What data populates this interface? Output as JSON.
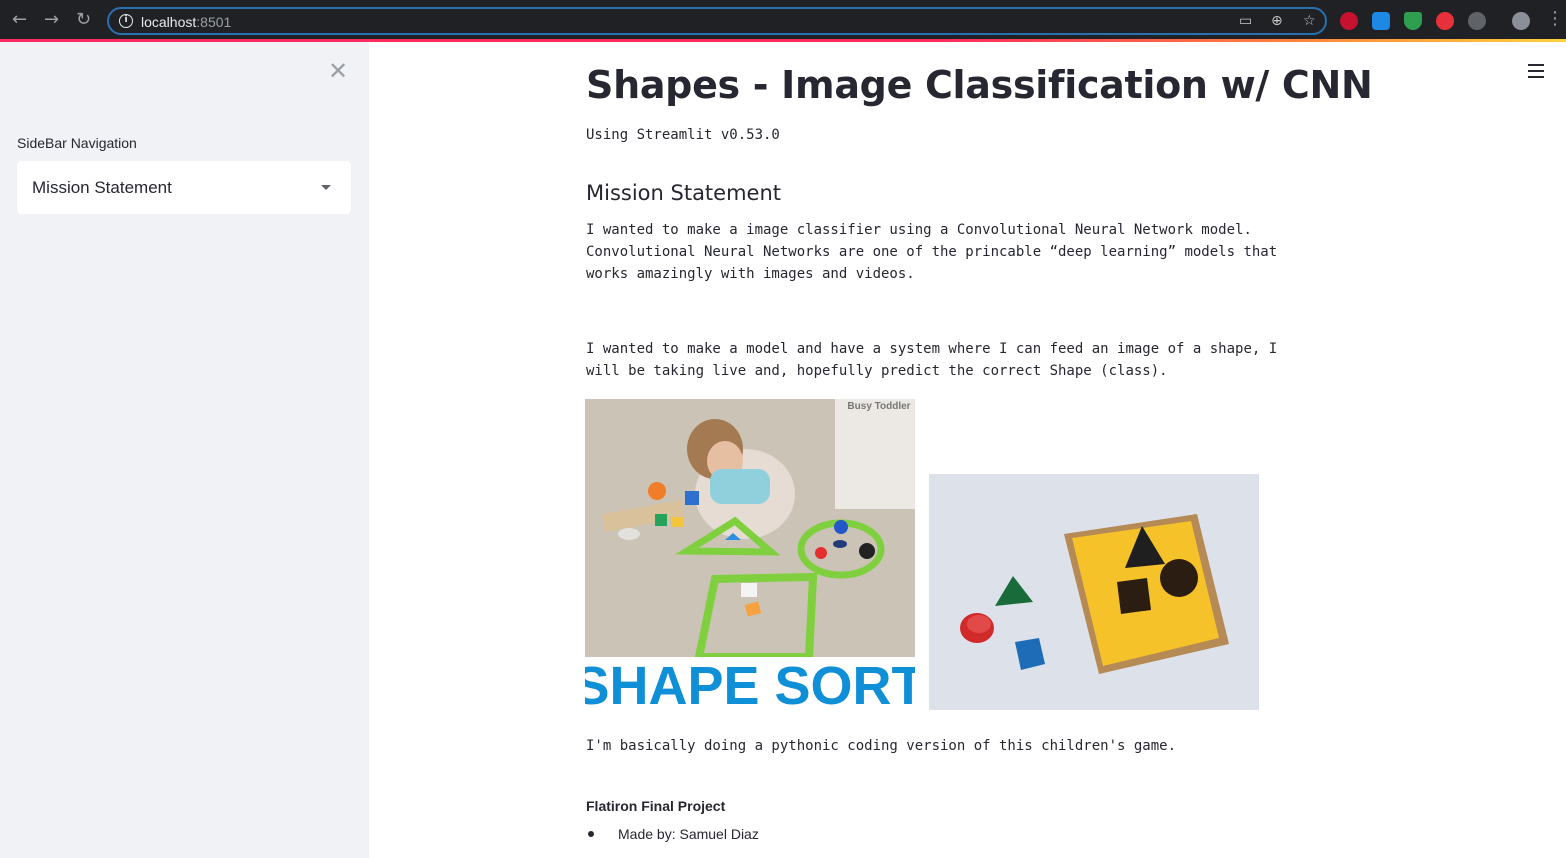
{
  "browser": {
    "url_host": "localhost",
    "url_port": ":8501",
    "extensions": [
      "ABP",
      "trello",
      "shield",
      "stop",
      "puzzle",
      "avatar"
    ]
  },
  "sidebar": {
    "label": "SideBar Navigation",
    "select_value": "Mission Statement"
  },
  "main": {
    "title": "Shapes - Image Classification w/ CNN",
    "version": "Using Streamlit v0.53.0",
    "section_heading": "Mission Statement",
    "paragraph_1": "I wanted to make a image classifier using a Convolutional Neural Network model. Convolutional Neural Networks are one of the princable “deep learning” models that works amazingly with images and videos.",
    "paragraph_2": "I wanted to make a model and have a system where I can feed an image of a shape, I will be taking live and, hopefully predict the correct Shape (class).",
    "image_1": {
      "watermark": "Busy Toddler",
      "caption": "SHAPE SORT"
    },
    "paragraph_3": "I'm basically doing a pythonic coding version of this children's game.",
    "subheading": "Flatiron Final Project",
    "bullet_1": "Made by: Samuel Diaz"
  },
  "colors": {
    "accent_red": "#ff2b5e",
    "sidebar_bg": "#f0f2f6",
    "text": "#262730"
  }
}
